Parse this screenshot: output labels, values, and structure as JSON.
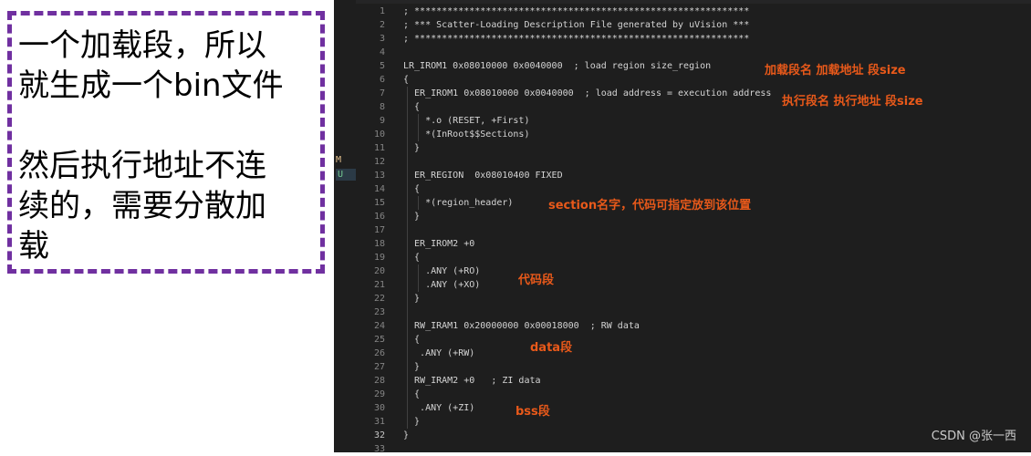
{
  "note": {
    "paragraph1": [
      "一个加载段，所以",
      "就生成一个bin文件"
    ],
    "paragraph2": [
      "然后执行地址不连",
      "续的，需要分散加",
      "载"
    ]
  },
  "editor": {
    "scm_markers": [
      "M",
      "U"
    ],
    "lines": [
      {
        "n": "1",
        "text": "; *************************************************************"
      },
      {
        "n": "2",
        "text": "; *** Scatter-Loading Description File generated by uVision ***"
      },
      {
        "n": "3",
        "text": "; *************************************************************"
      },
      {
        "n": "4",
        "text": ""
      },
      {
        "n": "5",
        "text": "LR_IROM1 0x08010000 0x0040000  ; load region size_region"
      },
      {
        "n": "6",
        "text": "{"
      },
      {
        "n": "7",
        "text": "  ER_IROM1 0x08010000 0x0040000  ; load address = execution address"
      },
      {
        "n": "8",
        "text": "  {"
      },
      {
        "n": "9",
        "text": "    *.o (RESET, +First)"
      },
      {
        "n": "10",
        "text": "    *(InRoot$$Sections)"
      },
      {
        "n": "11",
        "text": "  }"
      },
      {
        "n": "12",
        "text": ""
      },
      {
        "n": "13",
        "text": "  ER_REGION  0x08010400 FIXED"
      },
      {
        "n": "14",
        "text": "  {"
      },
      {
        "n": "15",
        "text": "    *(region_header)"
      },
      {
        "n": "16",
        "text": "  }"
      },
      {
        "n": "17",
        "text": ""
      },
      {
        "n": "18",
        "text": "  ER_IROM2 +0"
      },
      {
        "n": "19",
        "text": "  {"
      },
      {
        "n": "20",
        "text": "    .ANY (+RO)"
      },
      {
        "n": "21",
        "text": "    .ANY (+XO)"
      },
      {
        "n": "22",
        "text": "  }"
      },
      {
        "n": "23",
        "text": ""
      },
      {
        "n": "24",
        "text": "  RW_IRAM1 0x20000000 0x00018000  ; RW data"
      },
      {
        "n": "25",
        "text": "  {"
      },
      {
        "n": "26",
        "text": "   .ANY (+RW)"
      },
      {
        "n": "27",
        "text": "  }"
      },
      {
        "n": "28",
        "text": "  RW_IRAM2 +0   ; ZI data"
      },
      {
        "n": "29",
        "text": "  {"
      },
      {
        "n": "30",
        "text": "   .ANY (+ZI)"
      },
      {
        "n": "31",
        "text": "  }"
      },
      {
        "n": "32",
        "text": "}"
      },
      {
        "n": "33",
        "text": ""
      }
    ],
    "active_line": "32"
  },
  "annotations": {
    "load_region": "加载段名  加载地址   段size",
    "exec_region": "执行段名   执行地址   段size",
    "section_name": "section名字，代码可指定放到该位置",
    "code_segment": "代码段",
    "data_segment": "data段",
    "bss_segment": "bss段"
  },
  "watermark": "CSDN @张一西"
}
